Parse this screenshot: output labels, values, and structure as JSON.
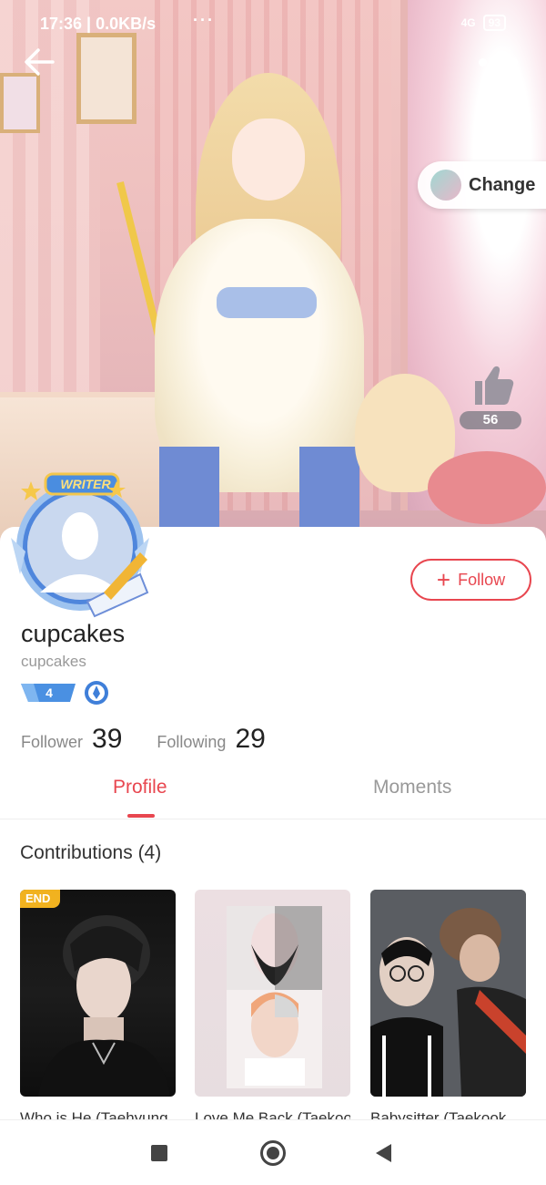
{
  "status_bar": {
    "time": "17:36",
    "net_speed": "0.0KB/s",
    "dots": "···",
    "network_label": "4G",
    "battery": "93"
  },
  "hero": {
    "change_label": "Change",
    "like_count": "56"
  },
  "profile": {
    "writer_badge": "WRITER",
    "username": "cupcakes",
    "handle": "cupcakes",
    "level": "4",
    "follow_label": "Follow",
    "follower_label": "Follower",
    "follower_count": "39",
    "following_label": "Following",
    "following_count": "29"
  },
  "tabs": [
    {
      "label": "Profile",
      "active": true
    },
    {
      "label": "Moments",
      "active": false
    }
  ],
  "contributions": {
    "title": "Contributions (4)",
    "books": [
      {
        "tag": "END",
        "title": "Who is He (Taehyung"
      },
      {
        "tag": "",
        "title": "Love Me Back (Taekook"
      },
      {
        "tag": "",
        "title": "Babysitter (Taekook"
      }
    ]
  },
  "colors": {
    "accent": "#e8464f",
    "end_tag": "#f1b21f",
    "level_badge": "#4a90e2"
  },
  "icons": {
    "back": "arrow-left-icon",
    "more": "more-dots-icon",
    "like": "thumbs-up-icon",
    "follow": "plus-icon",
    "medal": "quill-medal-icon",
    "nav_recent": "square-icon",
    "nav_home": "circle-icon",
    "nav_back": "triangle-back-icon"
  }
}
